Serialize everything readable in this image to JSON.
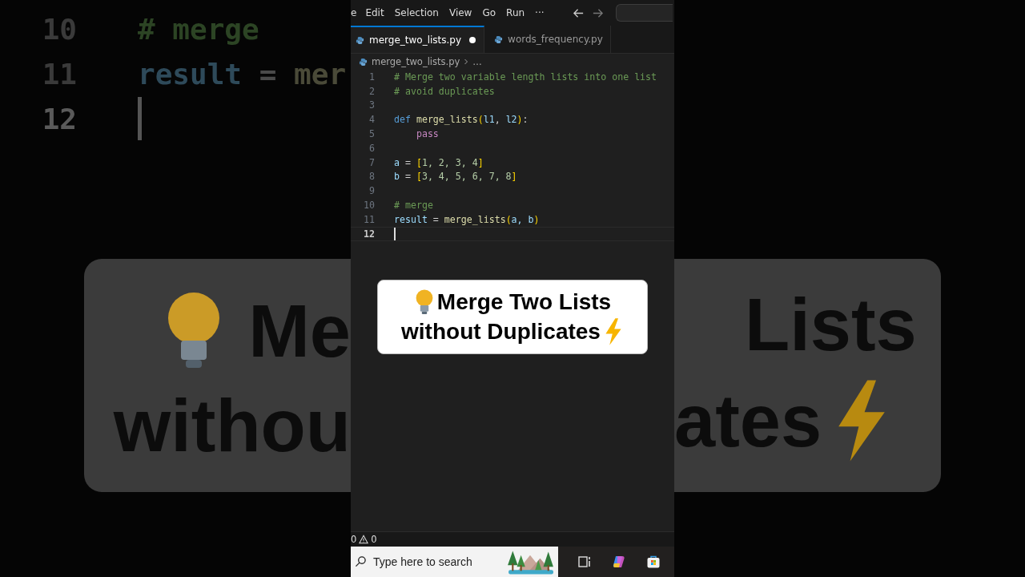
{
  "background": {
    "code_lines": [
      {
        "number": "10",
        "cursor": false,
        "tokens": [
          {
            "kind": "comment",
            "text": "# merge"
          }
        ]
      },
      {
        "number": "11",
        "cursor": false,
        "tokens": [
          {
            "kind": "variable",
            "text": "result"
          },
          {
            "kind": "operator",
            "text": " = "
          },
          {
            "kind": "function",
            "text": "mer"
          }
        ]
      },
      {
        "number": "12",
        "cursor": true
      }
    ],
    "caption_left": [
      "Me",
      "withou"
    ],
    "caption_right": [
      "Lists",
      "ates"
    ]
  },
  "menu": [
    {
      "label": "e"
    },
    {
      "label": "Edit"
    },
    {
      "label": "Selection"
    },
    {
      "label": "View"
    },
    {
      "label": "Go"
    },
    {
      "label": "Run"
    },
    {
      "label": "···"
    }
  ],
  "tabs": [
    {
      "label": "merge_two_lists.py",
      "selected": true,
      "modified": true
    },
    {
      "label": "words_frequency.py",
      "selected": false,
      "modified": false
    }
  ],
  "breadcrumb": [
    "merge_two_lists.py",
    "…"
  ],
  "code_lines": [
    {
      "number": "1",
      "cursor": false,
      "tokens": [
        {
          "kind": "comment",
          "text": "# Merge two variable length lists into one list"
        }
      ]
    },
    {
      "number": "2",
      "cursor": false,
      "tokens": [
        {
          "kind": "comment",
          "text": "# avoid duplicates"
        }
      ]
    },
    {
      "number": "3",
      "cursor": false
    },
    {
      "number": "4",
      "cursor": false,
      "tokens": [
        {
          "kind": "keyword",
          "text": "def "
        },
        {
          "kind": "function",
          "text": "merge_lists"
        },
        {
          "kind": "bracket",
          "text": "("
        },
        {
          "kind": "variable",
          "text": "l1"
        },
        {
          "kind": "plain",
          "text": ", "
        },
        {
          "kind": "variable",
          "text": "l2"
        },
        {
          "kind": "bracket",
          "text": ")"
        },
        {
          "kind": "plain",
          "text": ":"
        }
      ]
    },
    {
      "number": "5",
      "cursor": false,
      "tokens": [
        {
          "kind": "control",
          "text": "    pass"
        }
      ]
    },
    {
      "number": "6",
      "cursor": false
    },
    {
      "number": "7",
      "cursor": false,
      "tokens": [
        {
          "kind": "variable",
          "text": "a"
        },
        {
          "kind": "operator",
          "text": " = "
        },
        {
          "kind": "bracket",
          "text": "["
        },
        {
          "kind": "number",
          "text": "1, 2, 3, 4"
        },
        {
          "kind": "bracket",
          "text": "]"
        }
      ]
    },
    {
      "number": "8",
      "cursor": false,
      "tokens": [
        {
          "kind": "variable",
          "text": "b"
        },
        {
          "kind": "operator",
          "text": " = "
        },
        {
          "kind": "bracket",
          "text": "["
        },
        {
          "kind": "number",
          "text": "3, 4, 5, 6, 7, 8"
        },
        {
          "kind": "bracket",
          "text": "]"
        }
      ]
    },
    {
      "number": "9",
      "cursor": false
    },
    {
      "number": "10",
      "cursor": false,
      "tokens": [
        {
          "kind": "comment",
          "text": "# merge"
        }
      ]
    },
    {
      "number": "11",
      "cursor": false,
      "tokens": [
        {
          "kind": "variable",
          "text": "result"
        },
        {
          "kind": "operator",
          "text": " = "
        },
        {
          "kind": "function",
          "text": "merge_lists"
        },
        {
          "kind": "bracket",
          "text": "("
        },
        {
          "kind": "variable",
          "text": "a, b"
        },
        {
          "kind": "bracket",
          "text": ")"
        }
      ]
    },
    {
      "number": "12",
      "cursor": true
    }
  ],
  "caption": [
    "Merge Two Lists",
    "without Duplicates"
  ],
  "status": {
    "errors": "0",
    "warnings": "0"
  },
  "taskbar": {
    "search_placeholder": "Type here to search"
  }
}
